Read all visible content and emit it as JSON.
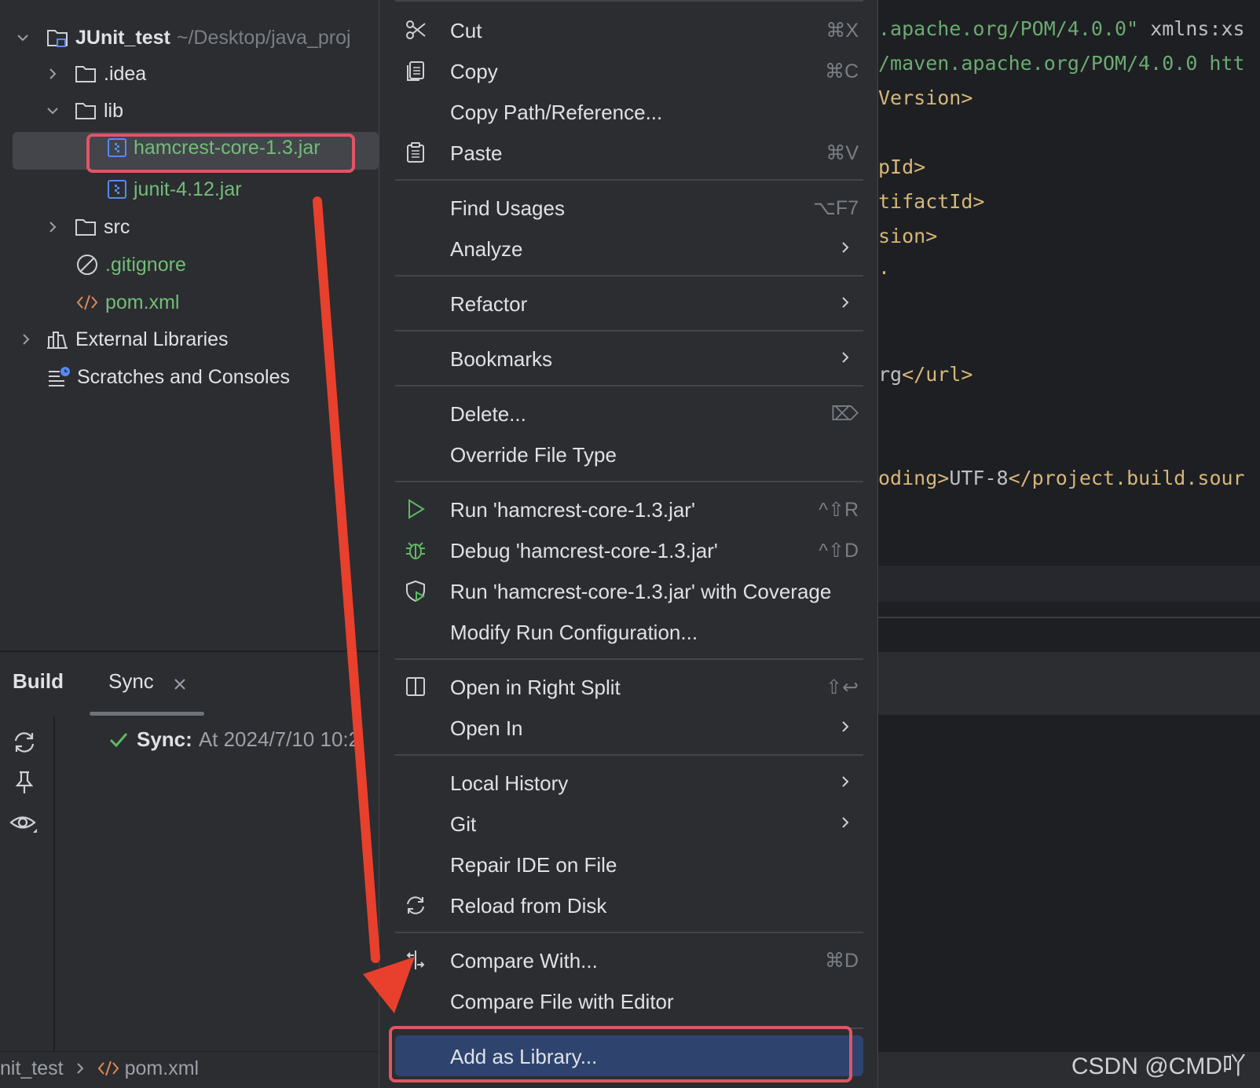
{
  "project_tree": {
    "root": {
      "name": "JUnit_test",
      "path": "~/Desktop/java_proj"
    },
    "items": [
      {
        "label": ".idea"
      },
      {
        "label": "lib"
      },
      {
        "label": "hamcrest-core-1.3.jar"
      },
      {
        "label": "junit-4.12.jar"
      },
      {
        "label": "src"
      },
      {
        "label": ".gitignore"
      },
      {
        "label": "pom.xml"
      },
      {
        "label": "External Libraries"
      },
      {
        "label": "Scratches and Consoles"
      }
    ]
  },
  "build_panel": {
    "tabs": [
      "Build",
      "Sync"
    ],
    "sync_label": "Sync:",
    "sync_text": "At 2024/7/10 10:2"
  },
  "status_bar": {
    "crumb_project": "nit_test",
    "crumb_file": "pom.xml"
  },
  "editor": {
    "lines": [
      [
        ".apache.org/POM/4.0.0\"",
        " xmlns:xs"
      ],
      [
        "/maven.apache.org/POM/4.0.0 htt"
      ],
      [
        "Version>"
      ],
      [
        "pId>"
      ],
      [
        "tifactId>"
      ],
      [
        "sion>"
      ],
      [
        "."
      ],
      [
        "rg",
        "</url>"
      ],
      [
        "oding>",
        "UTF-8",
        "</project.build.sour"
      ]
    ]
  },
  "context_menu": {
    "items": [
      {
        "label": "Cut",
        "shortcut": "⌘X",
        "icon": "scissors-icon"
      },
      {
        "label": "Copy",
        "shortcut": "⌘C",
        "icon": "copy-icon"
      },
      {
        "label": "Copy Path/Reference...",
        "shortcut": ""
      },
      {
        "label": "Paste",
        "shortcut": "⌘V",
        "icon": "clipboard-icon"
      },
      {
        "label": "Find Usages",
        "shortcut": "⌥F7"
      },
      {
        "label": "Analyze",
        "submenu": true
      },
      {
        "label": "Refactor",
        "submenu": true
      },
      {
        "label": "Bookmarks",
        "submenu": true
      },
      {
        "label": "Delete...",
        "shortcut": "⌦"
      },
      {
        "label": "Override File Type"
      },
      {
        "label": "Run 'hamcrest-core-1.3.jar'",
        "shortcut": "^⇧R",
        "icon": "run-icon"
      },
      {
        "label": "Debug 'hamcrest-core-1.3.jar'",
        "shortcut": "^⇧D",
        "icon": "debug-icon"
      },
      {
        "label": "Run 'hamcrest-core-1.3.jar' with Coverage",
        "icon": "coverage-icon"
      },
      {
        "label": "Modify Run Configuration..."
      },
      {
        "label": "Open in Right Split",
        "shortcut": "⇧↩",
        "icon": "split-icon"
      },
      {
        "label": "Open In",
        "submenu": true
      },
      {
        "label": "Local History",
        "submenu": true
      },
      {
        "label": "Git",
        "submenu": true
      },
      {
        "label": "Repair IDE on File"
      },
      {
        "label": "Reload from Disk",
        "icon": "reload-icon"
      },
      {
        "label": "Compare With...",
        "shortcut": "⌘D",
        "icon": "compare-icon"
      },
      {
        "label": "Compare File with Editor"
      },
      {
        "label": "Add as Library...",
        "highlighted": true
      }
    ]
  },
  "watermark": "CSDN @CMD吖",
  "colors": {
    "accent_red": "#e05565",
    "arrow_red": "#e8402c",
    "selection_blue": "#2e436e",
    "jar_green": "#73bd79"
  }
}
